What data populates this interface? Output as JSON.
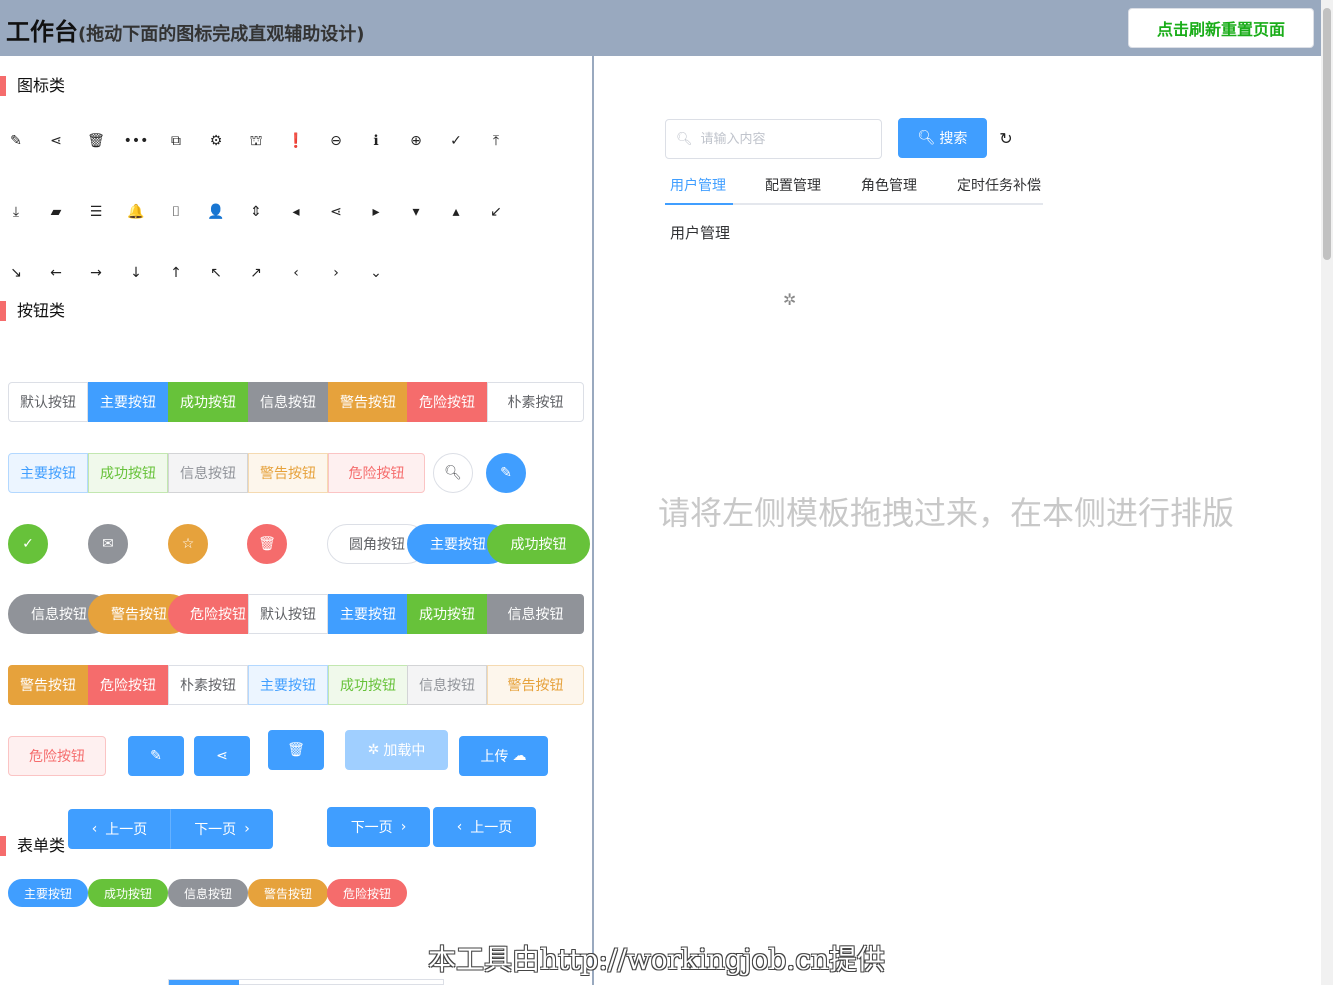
{
  "header": {
    "title": "工作台",
    "subtitle": "(拖动下面的图标完成直观辅助设计)",
    "refresh_label": "点击刷新重置页面"
  },
  "sections": {
    "icons": "图标类",
    "buttons": "按钮类",
    "forms": "表单类"
  },
  "icon_rows": [
    [
      {
        "name": "edit-icon",
        "glyph": "✎"
      },
      {
        "name": "share-icon",
        "glyph": "⋖"
      },
      {
        "name": "delete-icon",
        "glyph": "🗑"
      },
      {
        "name": "more-icon",
        "glyph": "•••"
      },
      {
        "name": "copy-icon",
        "glyph": "⧉"
      },
      {
        "name": "setting-icon",
        "glyph": "⚙"
      },
      {
        "name": "shopping-bag-icon",
        "glyph": "⛫"
      },
      {
        "name": "warning-icon",
        "glyph": "❗"
      },
      {
        "name": "zoom-out-icon",
        "glyph": "⊖"
      },
      {
        "name": "info-icon",
        "glyph": "ℹ"
      },
      {
        "name": "zoom-in-icon",
        "glyph": "⊕"
      },
      {
        "name": "circle-check-icon",
        "glyph": "✓"
      },
      {
        "name": "upload-icon",
        "glyph": "⤒"
      }
    ],
    [
      {
        "name": "download-icon",
        "glyph": "⤓"
      },
      {
        "name": "suitcase-icon",
        "glyph": "▰"
      },
      {
        "name": "menu-icon",
        "glyph": "☰"
      },
      {
        "name": "bell-icon",
        "glyph": "🔔"
      },
      {
        "name": "camera-icon",
        "glyph": "⌷"
      },
      {
        "name": "user-icon",
        "glyph": "👤"
      },
      {
        "name": "sort-icon",
        "glyph": "⇕"
      },
      {
        "name": "caret-left-icon",
        "glyph": "◂"
      },
      {
        "name": "share-solid-icon",
        "glyph": "⋖"
      },
      {
        "name": "caret-right-icon",
        "glyph": "▸"
      },
      {
        "name": "caret-bottom-icon",
        "glyph": "▾"
      },
      {
        "name": "caret-top-icon",
        "glyph": "▴"
      },
      {
        "name": "bottom-left-arrow-icon",
        "glyph": "↙"
      }
    ],
    [
      {
        "name": "bottom-right-arrow-icon",
        "glyph": "↘"
      },
      {
        "name": "back-arrow-icon",
        "glyph": "←"
      },
      {
        "name": "right-arrow-icon",
        "glyph": "→"
      },
      {
        "name": "bottom-arrow-icon",
        "glyph": "↓"
      },
      {
        "name": "top-arrow-icon",
        "glyph": "↑"
      },
      {
        "name": "top-left-arrow-icon",
        "glyph": "↖"
      },
      {
        "name": "top-right-arrow-icon",
        "glyph": "↗"
      },
      {
        "name": "arrow-left-icon",
        "glyph": "‹"
      },
      {
        "name": "arrow-right-icon",
        "glyph": "›"
      },
      {
        "name": "arrow-down-icon",
        "glyph": "⌄"
      }
    ]
  ],
  "buttons": {
    "default": "默认按钮",
    "primary": "主要按钮",
    "success": "成功按钮",
    "info": "信息按钮",
    "warning": "警告按钮",
    "danger": "危险按钮",
    "plain": "朴素按钮",
    "round": "圆角按钮",
    "loading": "加载中",
    "upload": "上传",
    "prev": "上一页",
    "next": "下一页"
  },
  "right": {
    "search_placeholder": "请输入内容",
    "search_label": "搜索",
    "tabs": [
      "用户管理",
      "配置管理",
      "角色管理",
      "定时任务补偿"
    ],
    "tab_content": "用户管理",
    "hint": "请将左侧模板拖拽过来，在本侧进行排版"
  },
  "watermark": "本工具由http://workingjob.cn提供"
}
